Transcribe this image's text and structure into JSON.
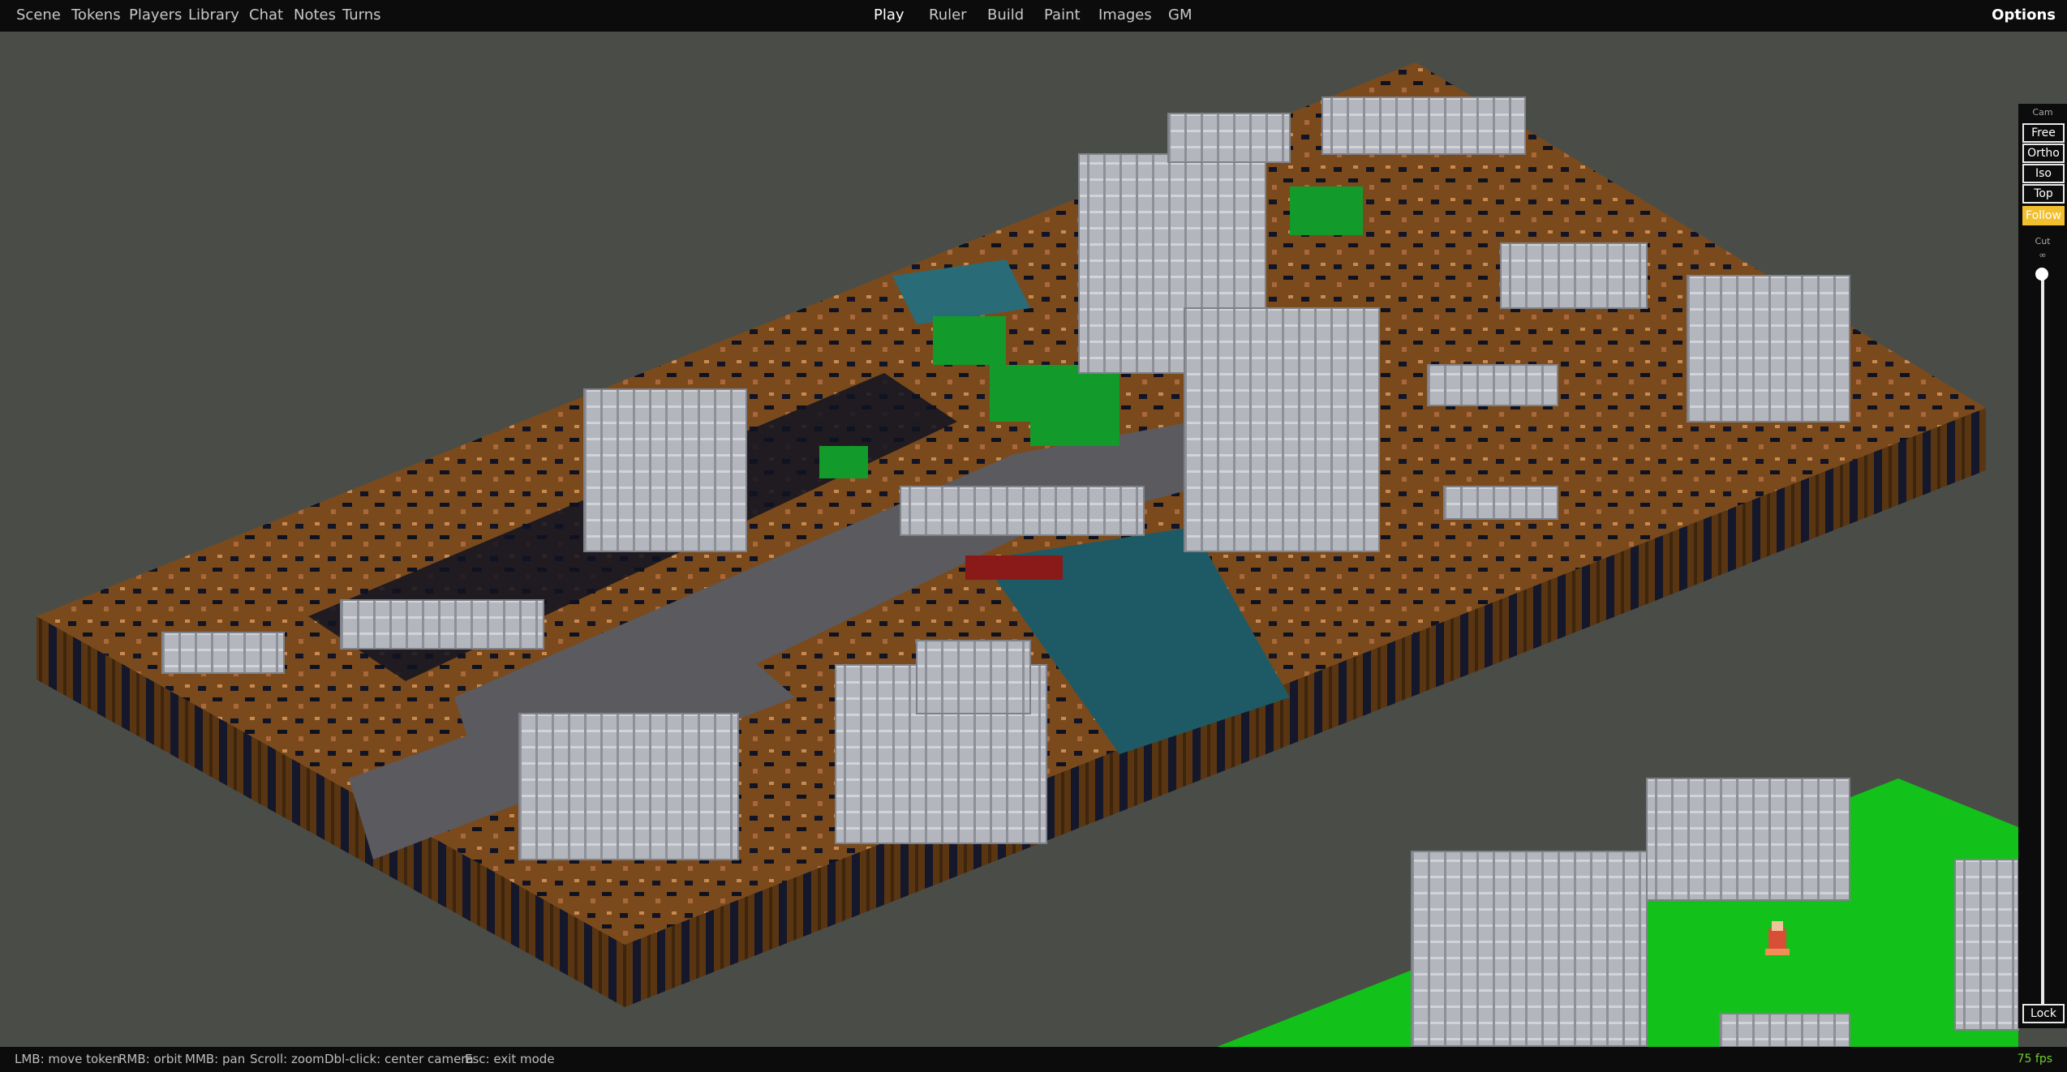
{
  "nav": {
    "left": [
      "Scene",
      "Tokens",
      "Players",
      "Library",
      "Chat",
      "Notes",
      "Turns"
    ],
    "center": [
      "Play",
      "Ruler",
      "Build",
      "Paint",
      "Images",
      "GM"
    ],
    "active": "Play",
    "options": "Options"
  },
  "camera_panel": {
    "cam_label": "Cam",
    "modes": [
      "Free",
      "Ortho",
      "Iso",
      "Top",
      "Follow"
    ],
    "active_mode": "Follow",
    "cut_label": "Cut",
    "cut_value": "∞",
    "lock_label": "Lock"
  },
  "status": {
    "hints": [
      "LMB: move token",
      "RMB: orbit",
      "MMB: pan",
      "Scroll: zoom",
      "Dbl-click: center camera",
      "Esc: exit mode"
    ],
    "fps": "75 fps"
  },
  "scene_icons": {
    "token": "adventurer-token-icon",
    "terrain": "voxel-terrain"
  },
  "colors": {
    "accent": "#f2bf2e",
    "fps_green": "#6fcf2f",
    "background": "#4a4d47",
    "dirt": "#7a4a1c",
    "grass": "#12c21a",
    "stone": "#b4b6bd",
    "water": "#1e5a66"
  }
}
